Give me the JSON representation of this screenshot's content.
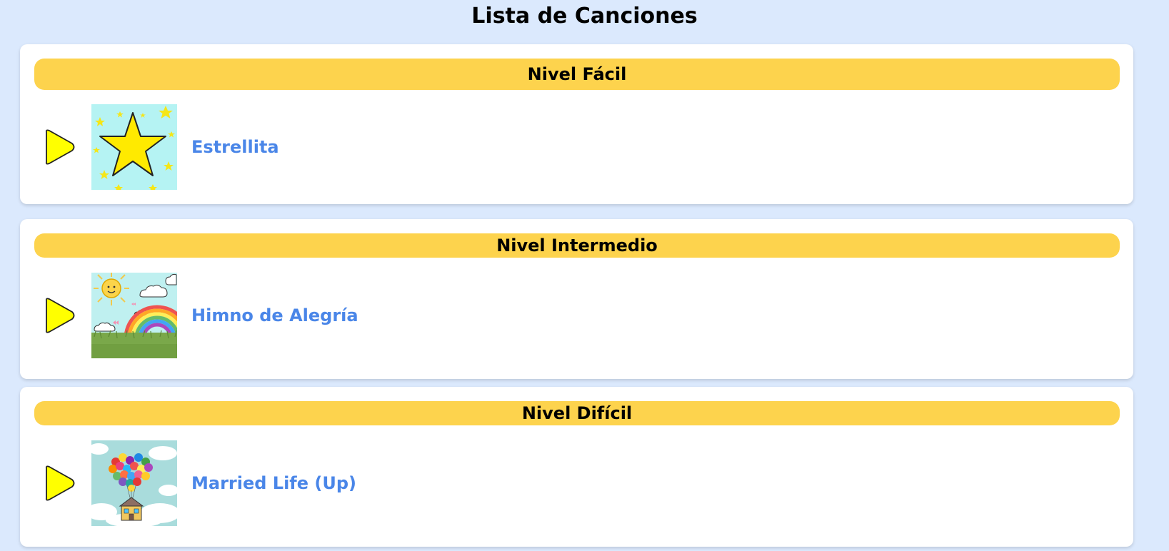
{
  "page": {
    "title": "Lista de Canciones"
  },
  "colors": {
    "background": "#dbe9fd",
    "card": "#ffffff",
    "level_header": "#fdd34d",
    "song_title": "#4a86e8",
    "play_icon": "#ffff00"
  },
  "levels": [
    {
      "name": "Nivel Fácil",
      "songs": [
        {
          "title": "Estrellita",
          "thumbnail": "star-thumbnail",
          "play_icon": "play-icon"
        }
      ]
    },
    {
      "name": "Nivel Intermedio",
      "songs": [
        {
          "title": "Himno de Alegría",
          "thumbnail": "sun-rainbow-thumbnail",
          "play_icon": "play-icon"
        }
      ]
    },
    {
      "name": "Nivel Difícil",
      "songs": [
        {
          "title": "Married Life (Up)",
          "thumbnail": "balloon-house-thumbnail",
          "play_icon": "play-icon"
        }
      ]
    }
  ]
}
